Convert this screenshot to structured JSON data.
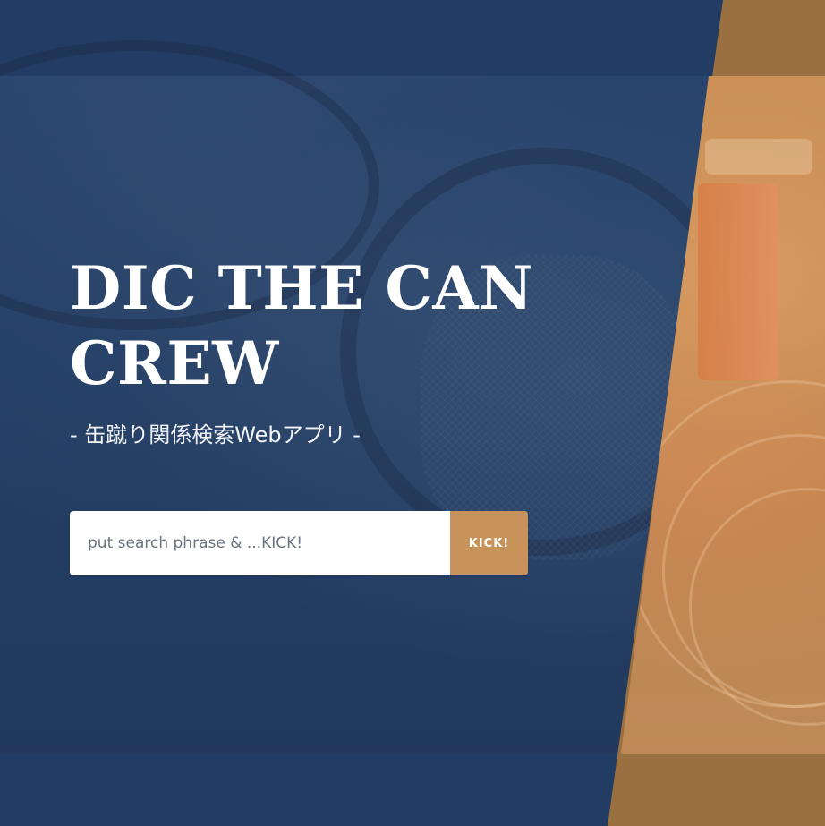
{
  "hero": {
    "title": "DIC THE CAN CREW",
    "subtitle": "- 缶蹴り関係検索Webアプリ -"
  },
  "search": {
    "placeholder": "put search phrase & ...KICK!",
    "value": "",
    "button_label": "KICK!"
  },
  "colors": {
    "background": "#223c63",
    "accent": "#c8935a",
    "accent_panel": "#9a7040",
    "text": "#ffffff"
  }
}
